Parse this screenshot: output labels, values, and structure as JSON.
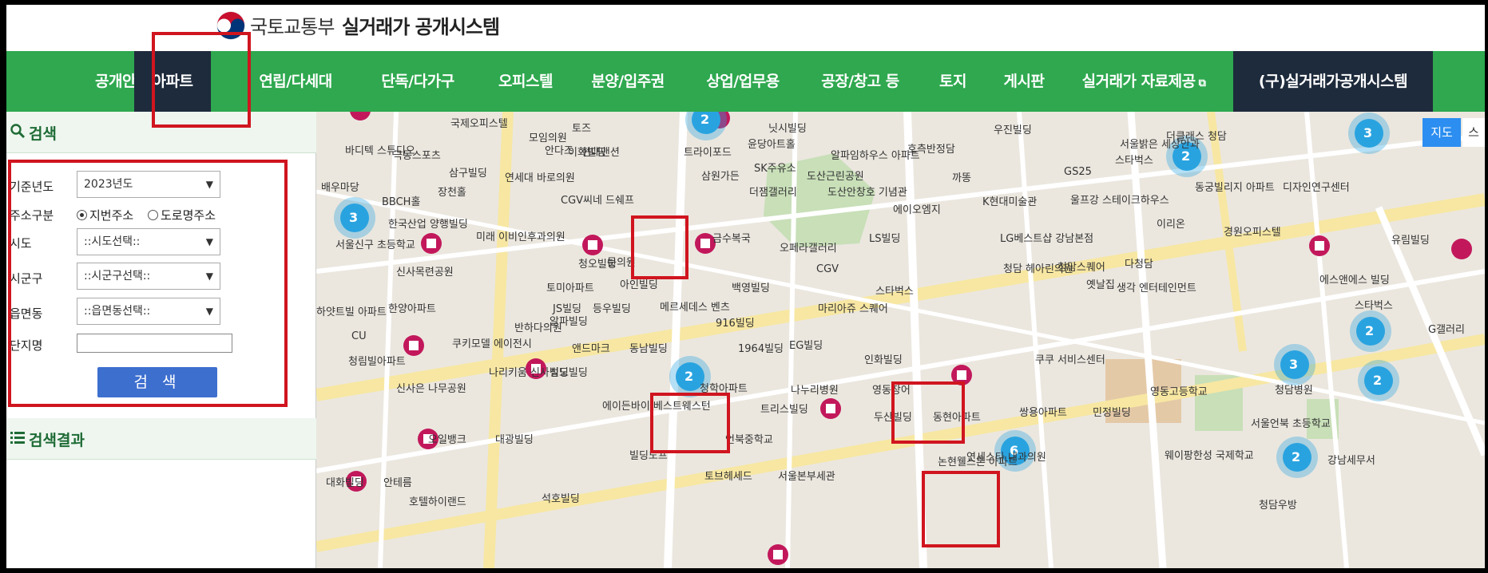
{
  "header": {
    "ministry": "국토교통부",
    "system": "실거래가 공개시스템"
  },
  "nav": {
    "items": [
      "공개안내",
      "아파트",
      "연립/다세대",
      "단독/다가구",
      "오피스텔",
      "분양/입주권",
      "상업/업무용",
      "공장/창고 등",
      "토지",
      "게시판",
      "실거래가 자료제공",
      "(구)실거래가공개시스템"
    ]
  },
  "search": {
    "title": "검색",
    "year_label": "기준년도",
    "year_value": "2023년도",
    "addr_type_label": "주소구분",
    "addr_opt1": "지번주소",
    "addr_opt2": "도로명주소",
    "sido_label": "시도",
    "sido_value": "::시도선택::",
    "sigungu_label": "시군구",
    "sigungu_value": "::시군구선택::",
    "eup_label": "읍면동",
    "eup_value": "::읍면동선택::",
    "complex_label": "단지명",
    "button": "검 색"
  },
  "results": {
    "title": "검색결과"
  },
  "map": {
    "type_button": "지도",
    "type_button2": "스",
    "labels": [
      "국제오피스텔",
      "바디텍 스튜디오",
      "극동스포츠",
      "모임의원",
      "토즈",
      "이화빌딩",
      "트라이포드",
      "윤당아트홀",
      "알파임하우스 아파트",
      "닛시빌딩",
      "호측반정담",
      "우진빌딩",
      "삼구빌딩",
      "연세대 바로의원",
      "안다즈",
      "현대맨션",
      "삼원가든",
      "SK주유소",
      "도산근린공원",
      "더클래스 청담",
      "서울밝은 세상안과",
      "배우마당",
      "BBCH홀",
      "장천홀",
      "CGV씨네 드쉐프",
      "더잼갤러리",
      "도산안창호 기념관",
      "까똥",
      "GS25",
      "스타벅스",
      "한국산업 양행빌딩",
      "미래 이비인후과의원",
      "금수복국",
      "에이오엠지",
      "K현대미술관",
      "울프강 스테이크하우스",
      "동궁빌리지 아파트",
      "디자인연구센터",
      "서울신구 초등학교",
      "신사목련공원",
      "청오빌딩",
      "오페라갤러리",
      "LS빌딩",
      "LG베스트샵 강남본점",
      "경원오피스텔",
      "이리온",
      "유림빌딩",
      "한양아파트",
      "토미아파트",
      "문의원",
      "아인빌딩",
      "CGV",
      "청담스퀘어",
      "청담 헤아린의원",
      "다청담",
      "옛날집",
      "에스앤에스 빌딩",
      "하얏트빌 아파트",
      "JS빌딩",
      "등우빌딩",
      "메르세데스 벤츠",
      "백영빌딩",
      "마리아쥬 스퀘어",
      "스타벅스",
      "생각 엔터테인먼트",
      "스타벅스",
      "CU",
      "반하다의원",
      "알파빌딩",
      "916빌딩",
      "G갤러리",
      "쿠키모델 에이전시",
      "앤드마크",
      "동남빌딩",
      "1964빌딩",
      "EG빌딩",
      "인화빌딩",
      "쿠쿠 서비스센터",
      "청림빌아파트",
      "성도빌딩",
      "나리키움 신사빌딩",
      "청학아파트",
      "나누리병원",
      "영동장어",
      "영동고등학교",
      "청담병원",
      "신사은 나무공원",
      "에이든바이 베스트웨스턴",
      "트리스빌딩",
      "두산빌딩",
      "동현아파트",
      "쌍용아파트",
      "민정빌딩",
      "서울언북 초등학교",
      "오일뱅크",
      "대광빌딩",
      "빌딩노프",
      "언북중학교",
      "웨이팡한성 국제학교",
      "강남세무서",
      "대화빌딩",
      "안테름",
      "호텔하이랜드",
      "석호빌딩",
      "토브헤세드",
      "서울본부세관",
      "논현웰스톤 아파트",
      "연세스타 내과의원",
      "청담우방"
    ],
    "clusters": [
      "2",
      "3",
      "2",
      "2",
      "3",
      "2",
      "3",
      "6",
      "2",
      "2"
    ]
  },
  "colors": {
    "nav_bg": "#2fa84f",
    "nav_active": "#1e2b3c",
    "highlight": "#d0151f",
    "search_button": "#3d6fcf",
    "marker": "#c2185b",
    "cluster": "#29a3e0"
  }
}
